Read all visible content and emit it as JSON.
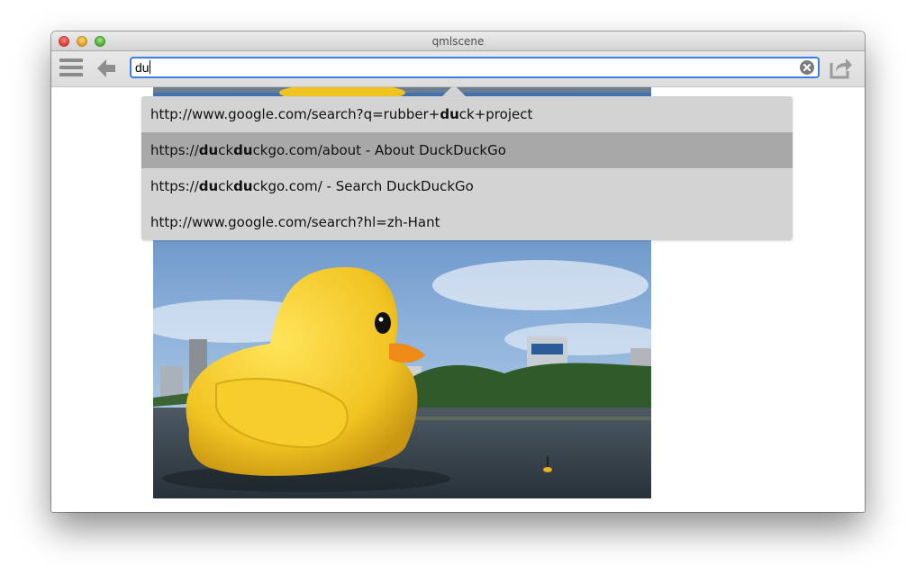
{
  "window": {
    "title": "qmlscene"
  },
  "toolbar": {
    "url_value": "du",
    "menu_icon": "hamburger-menu-icon",
    "back_icon": "back-arrow-icon",
    "clear_icon": "clear-circle-icon",
    "share_icon": "share-icon"
  },
  "suggestions": [
    {
      "parts": [
        {
          "t": "http://www.google.com/search?q=rubber+",
          "b": false
        },
        {
          "t": "du",
          "b": true
        },
        {
          "t": "ck+project",
          "b": false
        }
      ],
      "selected": false
    },
    {
      "parts": [
        {
          "t": "https://",
          "b": false
        },
        {
          "t": "du",
          "b": true
        },
        {
          "t": "ck",
          "b": false
        },
        {
          "t": "du",
          "b": true
        },
        {
          "t": "ckgo.com/about - About DuckDuckGo",
          "b": false
        }
      ],
      "selected": true
    },
    {
      "parts": [
        {
          "t": "https://",
          "b": false
        },
        {
          "t": "du",
          "b": true
        },
        {
          "t": "ck",
          "b": false
        },
        {
          "t": "du",
          "b": true
        },
        {
          "t": "ckgo.com/ - Search DuckDuckGo",
          "b": false
        }
      ],
      "selected": false
    },
    {
      "parts": [
        {
          "t": "http://www.google.com/search?hl=zh-Hant",
          "b": false
        }
      ],
      "selected": false
    }
  ],
  "colors": {
    "focus_ring": "#3d7fe0",
    "popup_bg": "#d3d3d3",
    "popup_selected": "#a8a8a8"
  }
}
